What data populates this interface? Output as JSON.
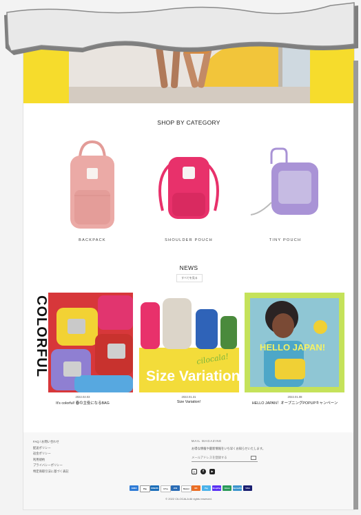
{
  "category_section": {
    "title": "SHOP BY CATEGORY",
    "items": [
      {
        "label": "BACKPACK",
        "color": "#ebaaa6"
      },
      {
        "label": "SHOULDER POUCH",
        "color": "#e8316b"
      },
      {
        "label": "TINY POUCH",
        "color": "#a993d6"
      }
    ]
  },
  "news_section": {
    "title": "NEWS",
    "view_all": "すべてを見る",
    "items": [
      {
        "date": "2022.02.03",
        "title": "It's colorful! 春の主役になるBAG",
        "image_text": "COLORFUL"
      },
      {
        "date": "2022.01.31",
        "title": "Size Variation!",
        "image_text": "Size Variation",
        "image_script": "cilocala!"
      },
      {
        "date": "2022.01.08",
        "title": "HELLO JAPAN！オープニングPOPUPキャンペーン",
        "image_text": "HELLO JAPAN!"
      }
    ]
  },
  "footer": {
    "links": [
      "FAQ / お問い合わせ",
      "配送ポリシー",
      "返金ポリシー",
      "利用規約",
      "プライバシーポリシー",
      "特定商取引法に基づく表記"
    ],
    "newsletter_heading": "MAIL MAGAZINE",
    "newsletter_desc": "お得な情報や最新情報をいち早くお知らせいたします。",
    "email_placeholder": "メールアドレスを登録する",
    "social_icons": [
      "instagram-icon",
      "facebook-icon",
      "youtube-icon"
    ],
    "payments": [
      "AMEX",
      "Pay",
      "DINERS",
      "GPay",
      "JCB",
      "Master",
      "MC",
      "Pay",
      "ShopPay",
      "Union",
      "VenmoPay",
      "VISA"
    ],
    "copyright": "© 2022 CILOCALA All rights reserved."
  }
}
